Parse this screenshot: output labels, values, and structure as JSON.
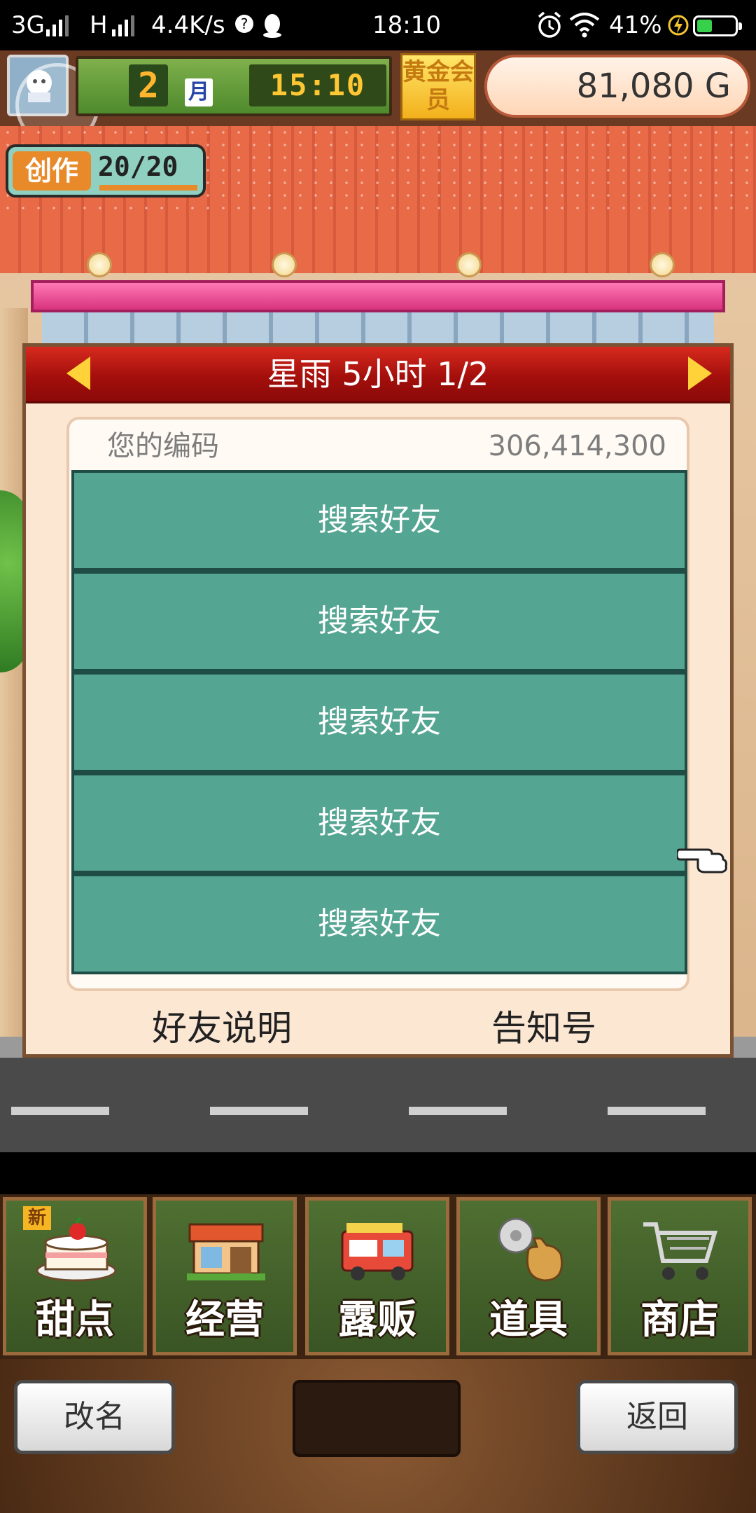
{
  "status_bar": {
    "network": "3G",
    "network2": "H",
    "speed": "4.4K/s",
    "time": "18:10",
    "battery_percent": "41%",
    "battery_level": 0.41,
    "icons": [
      "signal-icon",
      "help-icon",
      "qq-icon",
      "alarm-icon",
      "wifi-icon",
      "charging-icon",
      "battery-icon"
    ]
  },
  "hud": {
    "month": "2",
    "month_unit": "月",
    "clock": "15:10",
    "gold_member": "黄金会员",
    "money": "81,080 G"
  },
  "create_badge": {
    "label": "创作",
    "count": "20/20"
  },
  "panel": {
    "title": "星雨  5小时 1/2",
    "code_label": "您的编码",
    "code_value": "306,414,300",
    "slots": [
      "搜索好友",
      "搜索好友",
      "搜索好友",
      "搜索好友",
      "搜索好友"
    ],
    "footer_help": "好友说明",
    "footer_notice": "告知号"
  },
  "menu": {
    "new_badge": "新",
    "items": [
      {
        "label": "甜点",
        "icon": "cake-icon"
      },
      {
        "label": "经营",
        "icon": "shop-icon"
      },
      {
        "label": "露贩",
        "icon": "food-truck-icon"
      },
      {
        "label": "道具",
        "icon": "items-bag-icon"
      },
      {
        "label": "商店",
        "icon": "shopping-cart-icon"
      }
    ]
  },
  "bottom": {
    "rename": "改名",
    "back": "返回"
  },
  "colors": {
    "header_red": "#b71610",
    "slot_teal": "#55a593",
    "arrow_yellow": "#ffd23a",
    "menu_green": "#4f6f32"
  }
}
